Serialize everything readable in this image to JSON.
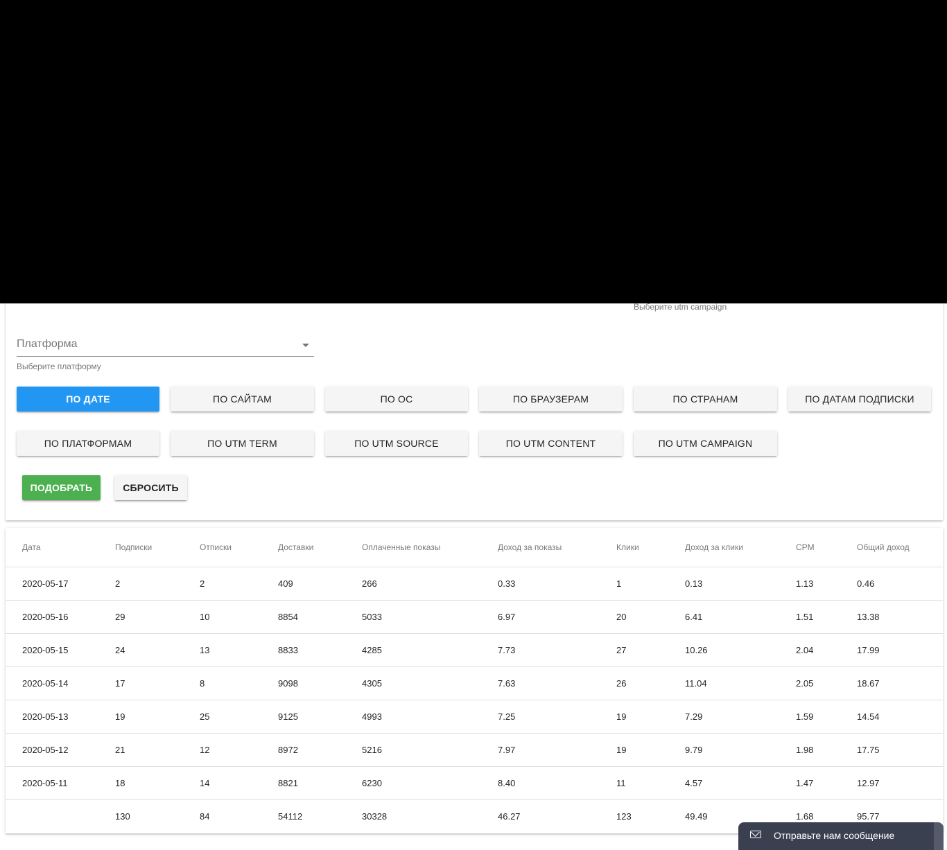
{
  "filters": {
    "utm_campaign_hint": "Выберите utm campaign",
    "platform": {
      "label": "Платформа",
      "hint": "Выберите платформу"
    }
  },
  "group_buttons": {
    "row1": [
      "По дате",
      "По сайтам",
      "По ОС",
      "По браузерам",
      "По странам",
      "По датам подписки"
    ],
    "row2": [
      "По платформам",
      "По utm term",
      "По utm source",
      "По utm content",
      "По utm campaign"
    ],
    "active": "По дате"
  },
  "actions": {
    "apply": "Подобрать",
    "reset": "Сбросить"
  },
  "table": {
    "columns": [
      "Дата",
      "Подписки",
      "Отписки",
      "Доставки",
      "Оплаченные показы",
      "Доход за показы",
      "Клики",
      "Доход за клики",
      "CPM",
      "Общий доход"
    ],
    "rows": [
      [
        "2020-05-17",
        "2",
        "2",
        "409",
        "266",
        "0.33",
        "1",
        "0.13",
        "1.13",
        "0.46"
      ],
      [
        "2020-05-16",
        "29",
        "10",
        "8854",
        "5033",
        "6.97",
        "20",
        "6.41",
        "1.51",
        "13.38"
      ],
      [
        "2020-05-15",
        "24",
        "13",
        "8833",
        "4285",
        "7.73",
        "27",
        "10.26",
        "2.04",
        "17.99"
      ],
      [
        "2020-05-14",
        "17",
        "8",
        "9098",
        "4305",
        "7.63",
        "26",
        "11.04",
        "2.05",
        "18.67"
      ],
      [
        "2020-05-13",
        "19",
        "25",
        "9125",
        "4993",
        "7.25",
        "19",
        "7.29",
        "1.59",
        "14.54"
      ],
      [
        "2020-05-12",
        "21",
        "12",
        "8972",
        "5216",
        "7.97",
        "19",
        "9.79",
        "1.98",
        "17.75"
      ],
      [
        "2020-05-11",
        "18",
        "14",
        "8821",
        "6230",
        "8.40",
        "11",
        "4.57",
        "1.47",
        "12.97"
      ]
    ],
    "totals": [
      "",
      "130",
      "84",
      "54112",
      "30328",
      "46.27",
      "123",
      "49.49",
      "1.68",
      "95.77"
    ]
  },
  "chat": {
    "label": "Отправьте нам сообщение"
  },
  "colors": {
    "primary": "#2196f3",
    "success": "#4caf50",
    "chat_bg": "#3a4050"
  }
}
